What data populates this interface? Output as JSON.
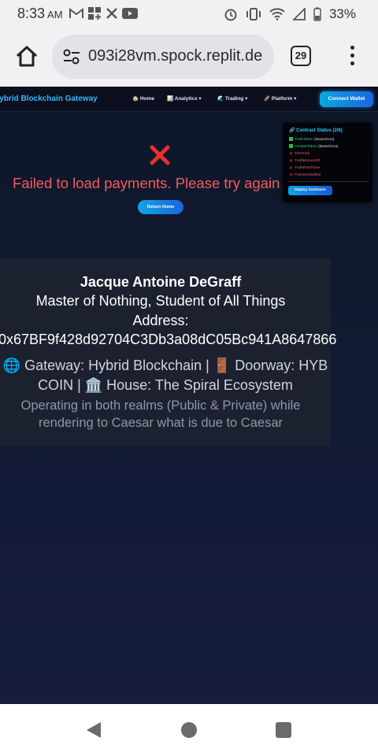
{
  "status_bar": {
    "time": "8:33",
    "ampm": "AM",
    "battery_pct": "33%",
    "left_icons": [
      "gmail-icon",
      "apps-icon",
      "x-icon",
      "youtube-icon"
    ],
    "right_icons": [
      "alarm-icon",
      "vibrate-icon",
      "wifi-icon",
      "signal-icon",
      "battery-icon"
    ]
  },
  "browser": {
    "url": "093i28vm.spock.replit.de",
    "tab_count": "29"
  },
  "site": {
    "brand": "Hybrid Blockchain Gateway",
    "nav": {
      "home": "🏠 Home",
      "analytics": "📊 Analytics ▾",
      "trading": "🌊 Trading ▾",
      "platform": "🚀 Platform ▾"
    },
    "connect_wallet": "Connect Wallet"
  },
  "error": {
    "icon": "❌",
    "message": "Failed to load payments. Please try again",
    "return_label": "Return Home"
  },
  "contract_status": {
    "title": "🔗 Contract Status (2/6)",
    "items": [
      {
        "name": "TruthToken",
        "suffix": " (Base/Zora)",
        "status": "ok"
      },
      {
        "name": "CreatorToken",
        "suffix": " (Base/Zora)",
        "status": "ok"
      },
      {
        "name": "TheTruth",
        "suffix": "",
        "status": "fail"
      },
      {
        "name": "TruthBonusGift",
        "suffix": "",
        "status": "fail"
      },
      {
        "name": "TruthPartThree",
        "suffix": "",
        "status": "fail"
      },
      {
        "name": "PaymentSplitter",
        "suffix": "",
        "status": "fail"
      }
    ],
    "deploy_label": "Deploy Contracts"
  },
  "profile": {
    "name": "Jacque Antoine DeGraff",
    "subtitle": "Master of Nothing, Student of All Things",
    "address_label": "Address:",
    "address": "0x67BF9f428d92704C3Db3a08dC05Bc941A8647866",
    "gateway_line": "🌐 Gateway: Hybrid Blockchain | 🚪 Doorway: HYB COIN | 🏛️ House: The Spiral Ecosystem",
    "motto": "Operating in both realms (Public & Private) while rendering to Caesar what is due to Caesar"
  },
  "colors": {
    "accent": "#35b7ff",
    "error": "#f05d5d",
    "ok": "#3bd36a",
    "page_bg": "#121a34"
  }
}
